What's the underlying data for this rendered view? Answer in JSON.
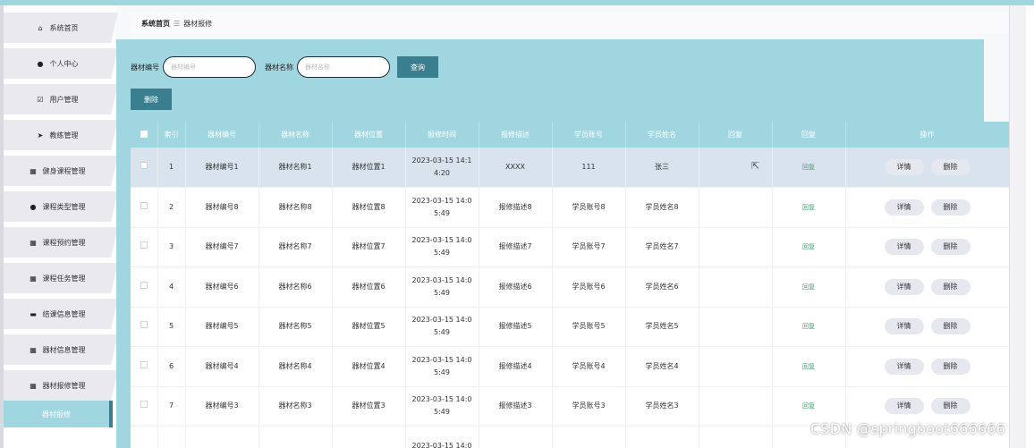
{
  "sidebar": {
    "items": [
      {
        "label": "系统首页",
        "icon": "home-icon",
        "glyph": "⌂"
      },
      {
        "label": "个人中心",
        "icon": "user-icon",
        "glyph": "●"
      },
      {
        "label": "用户管理",
        "icon": "checkbox-icon",
        "glyph": "☑"
      },
      {
        "label": "教练管理",
        "icon": "send-icon",
        "glyph": "➤"
      },
      {
        "label": "健身课程管理",
        "icon": "grid-icon",
        "glyph": "▦"
      },
      {
        "label": "课程类型管理",
        "icon": "user-icon",
        "glyph": "●"
      },
      {
        "label": "课程预约管理",
        "icon": "grid-icon",
        "glyph": "▦"
      },
      {
        "label": "课程任务管理",
        "icon": "apps-icon",
        "glyph": "▦"
      },
      {
        "label": "结课信息管理",
        "icon": "monitor-icon",
        "glyph": "▬"
      },
      {
        "label": "器材信息管理",
        "icon": "grid-icon",
        "glyph": "▦"
      },
      {
        "label": "器材报修管理",
        "icon": "grid-icon",
        "glyph": "▦"
      }
    ],
    "active_sub": "器材报修"
  },
  "breadcrumb": {
    "home": "系统首页",
    "sep": "☰",
    "current": "器材报修"
  },
  "search": {
    "code_label": "器材编号",
    "code_placeholder": "器材编号",
    "name_label": "器材名称",
    "name_placeholder": "器材名称",
    "query_button": "查询"
  },
  "toolbar": {
    "delete_button": "删除"
  },
  "table": {
    "headers": [
      "索引",
      "器材编号",
      "器材名称",
      "器材位置",
      "报修时间",
      "报修描述",
      "学员账号",
      "学员姓名",
      "回复",
      "回复",
      "操作"
    ],
    "rows": [
      {
        "index": "1",
        "code": "器材编号1",
        "name": "器材名称1",
        "location": "器材位置1",
        "time": "2023-03-15 14:1 4:20",
        "desc": "XXXX",
        "account": "111",
        "student": "张三",
        "reply_text": "",
        "reply": "回复"
      },
      {
        "index": "2",
        "code": "器材编号8",
        "name": "器材名称8",
        "location": "器材位置8",
        "time": "2023-03-15 14:0 5:49",
        "desc": "报修描述8",
        "account": "学员账号8",
        "student": "学员姓名8",
        "reply_text": "",
        "reply": "回复"
      },
      {
        "index": "3",
        "code": "器材编号7",
        "name": "器材名称7",
        "location": "器材位置7",
        "time": "2023-03-15 14:0 5:49",
        "desc": "报修描述7",
        "account": "学员账号7",
        "student": "学员姓名7",
        "reply_text": "",
        "reply": "回复"
      },
      {
        "index": "4",
        "code": "器材编号6",
        "name": "器材名称6",
        "location": "器材位置6",
        "time": "2023-03-15 14:0 5:49",
        "desc": "报修描述6",
        "account": "学员账号6",
        "student": "学员姓名6",
        "reply_text": "",
        "reply": "回复"
      },
      {
        "index": "5",
        "code": "器材编号5",
        "name": "器材名称5",
        "location": "器材位置5",
        "time": "2023-03-15 14:0 5:49",
        "desc": "报修描述5",
        "account": "学员账号5",
        "student": "学员姓名5",
        "reply_text": "",
        "reply": "回复"
      },
      {
        "index": "6",
        "code": "器材编号4",
        "name": "器材名称4",
        "location": "器材位置4",
        "time": "2023-03-15 14:0 5:49",
        "desc": "报修描述4",
        "account": "学员账号4",
        "student": "学员姓名4",
        "reply_text": "",
        "reply": "回复"
      },
      {
        "index": "7",
        "code": "器材编号3",
        "name": "器材名称3",
        "location": "器材位置3",
        "time": "2023-03-15 14:0 5:49",
        "desc": "报修描述3",
        "account": "学员账号3",
        "student": "学员姓名3",
        "reply_text": "",
        "reply": "回复"
      },
      {
        "index": "",
        "code": "",
        "name": "",
        "location": "",
        "time": "2023-03-15 14:0",
        "desc": "",
        "account": "",
        "student": "",
        "reply_text": "",
        "reply": ""
      }
    ],
    "detail_button": "详情",
    "delete_button": "删除"
  },
  "watermark": "CSDN @springboot666666",
  "colors": {
    "accent": "#9fd6e0",
    "button": "#3a7f8f",
    "reply": "#3aa66a",
    "selected_row": "#d9e3ee"
  }
}
